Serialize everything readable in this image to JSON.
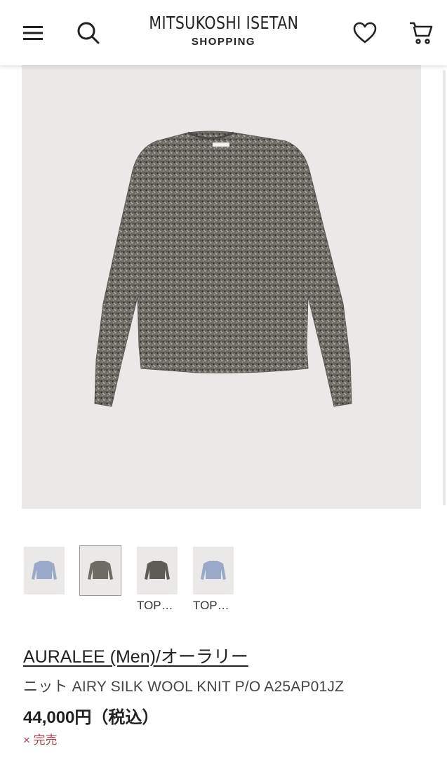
{
  "header": {
    "logo_title": "MITSUKOSHI ISETAN",
    "logo_subtitle": "SHOPPING",
    "icons": [
      "menu-icon",
      "search-icon",
      "heart-icon",
      "cart-icon"
    ]
  },
  "product": {
    "brand": "AURALEE (Men)/オーラリー",
    "name": "ニット AIRY SILK WOOL KNIT P/O A25AP01JZ",
    "price": "44,000円（税込）",
    "stock_mark": "×",
    "stock_text": "完売",
    "colors": {
      "grey_melange": "#6f6c66",
      "blue": "#9aa9c9",
      "sold_out": "#b0414e"
    }
  },
  "thumbnails": [
    {
      "caption": "",
      "color": "blue",
      "selected": false
    },
    {
      "caption": "",
      "color": "grey",
      "selected": true
    },
    {
      "caption": "TOP…",
      "color": "grey",
      "selected": false
    },
    {
      "caption": "TOP…",
      "color": "blue",
      "selected": false
    }
  ]
}
